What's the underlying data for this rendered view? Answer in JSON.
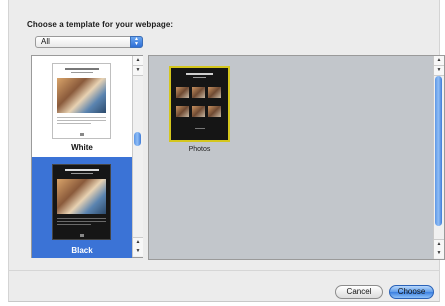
{
  "dialog": {
    "prompt": "Choose a template for your webpage:",
    "category_select": {
      "value": "All"
    }
  },
  "template_list": {
    "items": [
      {
        "label": "White",
        "selected": false
      },
      {
        "label": "Black",
        "selected": true
      }
    ]
  },
  "template_grid": {
    "items": [
      {
        "label": "Photos",
        "selected": true
      }
    ]
  },
  "buttons": {
    "cancel": "Cancel",
    "choose": "Choose"
  },
  "colors": {
    "selection_blue": "#3b73d6",
    "highlight_border": "#d4c61d",
    "pane_gray": "#c2c6cb",
    "dialog_bg": "#ececec"
  },
  "icons": {
    "popup_arrows": "updown-arrows-icon",
    "scroll_up": "arrow-up-icon",
    "scroll_down": "arrow-down-icon"
  }
}
